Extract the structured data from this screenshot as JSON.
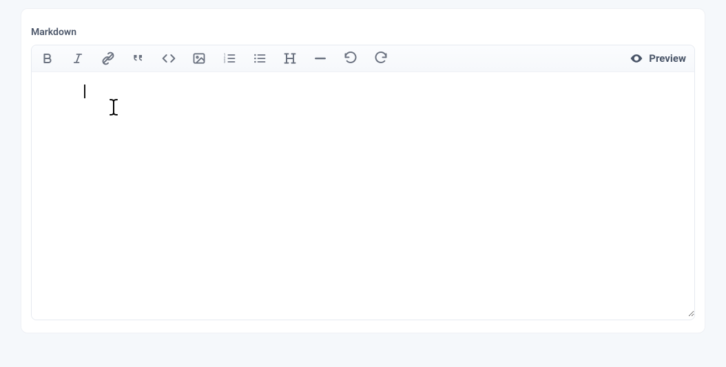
{
  "label": "Markdown",
  "toolbar": {
    "bold": "Bold",
    "italic": "Italic",
    "link": "Link",
    "quote": "Quote",
    "code": "Code",
    "image": "Image",
    "ordered_list": "Ordered List",
    "unordered_list": "Unordered List",
    "heading": "Heading",
    "hr": "Horizontal Rule",
    "undo": "Undo",
    "redo": "Redo"
  },
  "preview_label": "Preview",
  "textarea": {
    "value": "",
    "placeholder": ""
  }
}
